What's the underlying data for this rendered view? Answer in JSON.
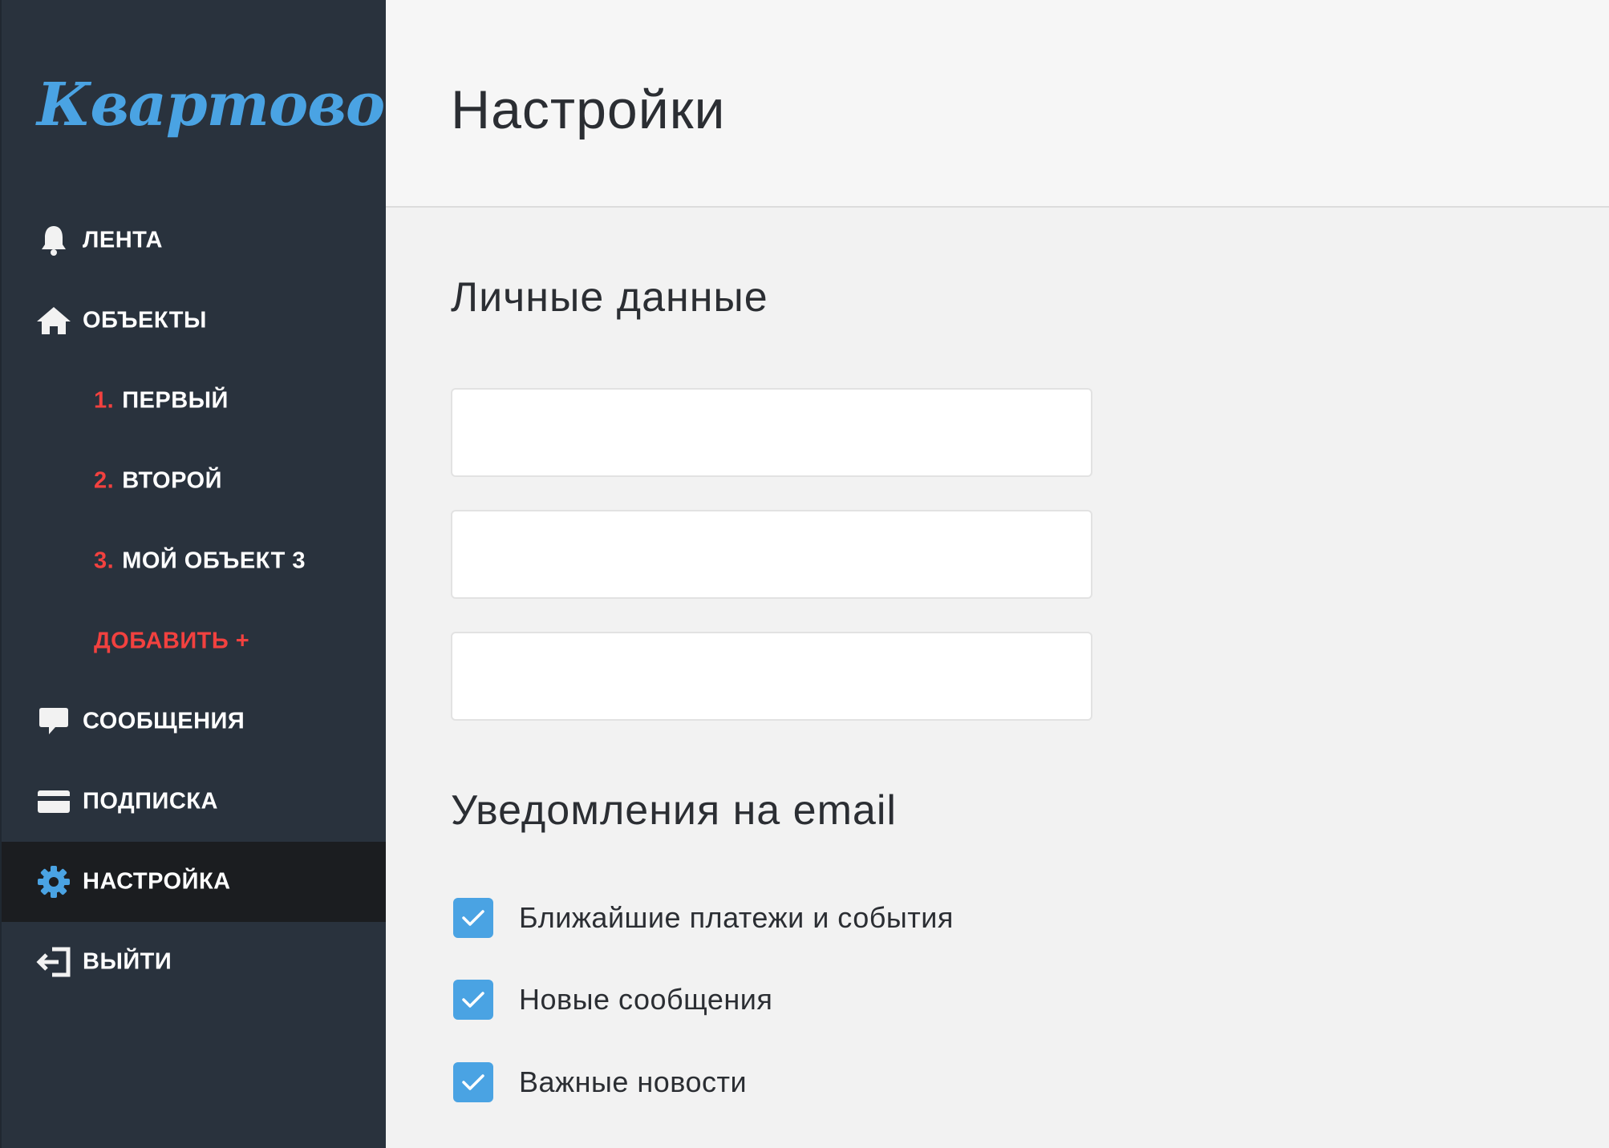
{
  "app": {
    "logo": "Квартовод"
  },
  "sidebar": {
    "items": [
      {
        "key": "feed",
        "label": "ЛЕНТА",
        "icon": "bell-icon"
      },
      {
        "key": "objects",
        "label": "ОБЪЕКТЫ",
        "icon": "home-icon"
      },
      {
        "key": "obj1",
        "num": "1.",
        "label": "ПЕРВЫЙ"
      },
      {
        "key": "obj2",
        "num": "2.",
        "label": "ВТОРОЙ"
      },
      {
        "key": "obj3",
        "num": "3.",
        "label": "МОЙ ОБЪЕКТ 3"
      },
      {
        "key": "add",
        "label": "ДОБАВИТЬ +"
      },
      {
        "key": "messages",
        "label": "СООБЩЕНИЯ",
        "icon": "chat-bubble-icon"
      },
      {
        "key": "subscription",
        "label": "ПОДПИСКА",
        "icon": "credit-card-icon"
      },
      {
        "key": "settings",
        "label": "НАСТРОЙКА",
        "icon": "gear-icon",
        "active": true
      },
      {
        "key": "logout",
        "label": "ВЫЙТИ",
        "icon": "logout-icon"
      }
    ]
  },
  "header": {
    "title": "Настройки"
  },
  "personal": {
    "title": "Личные данные",
    "fields": [
      {
        "value": "",
        "placeholder": ""
      },
      {
        "value": "",
        "placeholder": ""
      },
      {
        "value": "",
        "placeholder": ""
      }
    ]
  },
  "notifications": {
    "title": "Уведомления на email",
    "options": [
      {
        "label": "Ближайшие платежи и события",
        "checked": true
      },
      {
        "label": "Новые сообщения",
        "checked": true
      },
      {
        "label": "Важные новости",
        "checked": true
      }
    ]
  },
  "colors": {
    "sidebar_bg": "#29323d",
    "active_bg": "#1b1d20",
    "accent_blue": "#4aa3e3",
    "accent_red": "#f2413f"
  }
}
